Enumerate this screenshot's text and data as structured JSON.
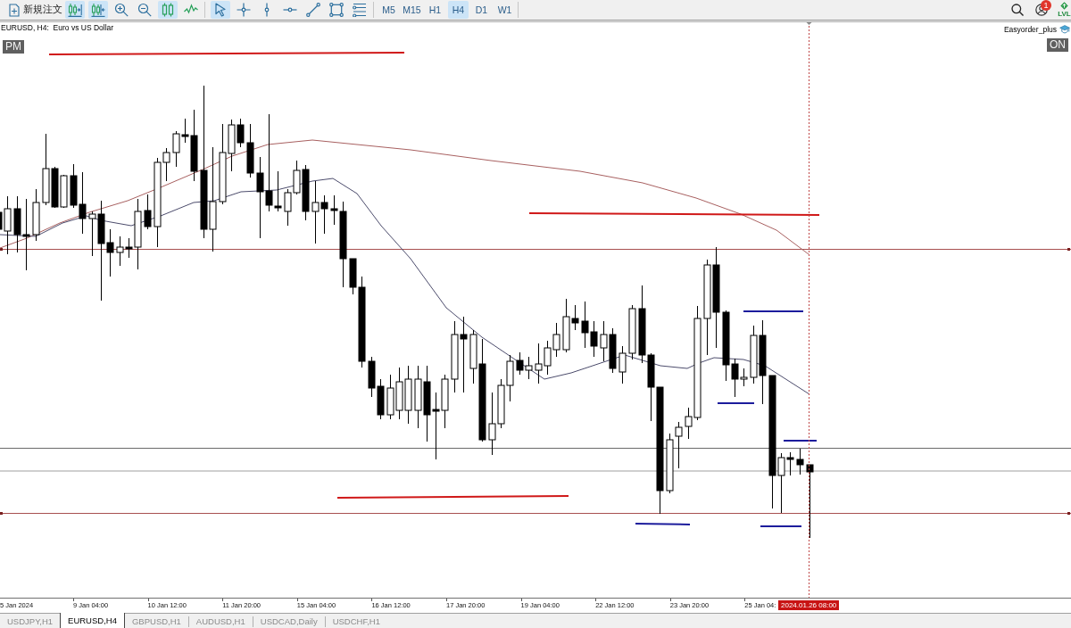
{
  "toolbar": {
    "new_order": {
      "label": "新規注文"
    },
    "chart_tools": [
      {
        "kind": "chart_shift",
        "on": true
      },
      {
        "kind": "auto_scroll",
        "on": true
      },
      {
        "kind": "zoom_in",
        "on": false
      },
      {
        "kind": "zoom_out",
        "on": false
      },
      {
        "kind": "candlesticks",
        "on": true
      },
      {
        "kind": "line_chart",
        "on": false
      }
    ],
    "drawing_tools": [
      {
        "kind": "cursor",
        "selected": true
      },
      {
        "kind": "crosshair",
        "selected": false
      },
      {
        "kind": "vertical_line",
        "selected": false
      },
      {
        "kind": "horizontal_line",
        "selected": false
      },
      {
        "kind": "trendline",
        "selected": false
      },
      {
        "kind": "rectangle",
        "selected": false
      },
      {
        "kind": "lines",
        "selected": false
      }
    ],
    "timeframes": [
      {
        "label": "M5",
        "selected": false
      },
      {
        "label": "M15",
        "selected": false
      },
      {
        "label": "H1",
        "selected": false
      },
      {
        "label": "H4",
        "selected": true
      },
      {
        "label": "D1",
        "selected": false
      },
      {
        "label": "W1",
        "selected": false
      }
    ],
    "notifications": {
      "count": "1"
    },
    "level_badge": {
      "label": "LVL"
    }
  },
  "chart": {
    "title": "EURUSD, H4:  Euro vs US Dollar",
    "session_label": "PM",
    "expert": {
      "name": "Easyorder_plus",
      "status": "ON"
    }
  },
  "time_axis": {
    "labels": [
      "5 Jan 2024",
      "9 Jan 04:00",
      "10 Jan 12:00",
      "11 Jan 20:00",
      "15 Jan 04:00",
      "16 Jan 12:00",
      "17 Jan 20:00",
      "19 Jan 04:00",
      "22 Jan 12:00",
      "23 Jan 20:00",
      "25 Jan 04:"
    ],
    "cursor_time": "2024.01.26 08:00"
  },
  "tabs": [
    {
      "label": "USDJPY,H1",
      "selected": false
    },
    {
      "label": "EURUSD,H4",
      "selected": true
    },
    {
      "label": "GBPUSD,H1",
      "selected": false
    },
    {
      "label": "AUDUSD,H1",
      "selected": false
    },
    {
      "label": "USDCAD,Daily",
      "selected": false
    },
    {
      "label": "USDCHF,H1",
      "selected": false
    }
  ]
}
